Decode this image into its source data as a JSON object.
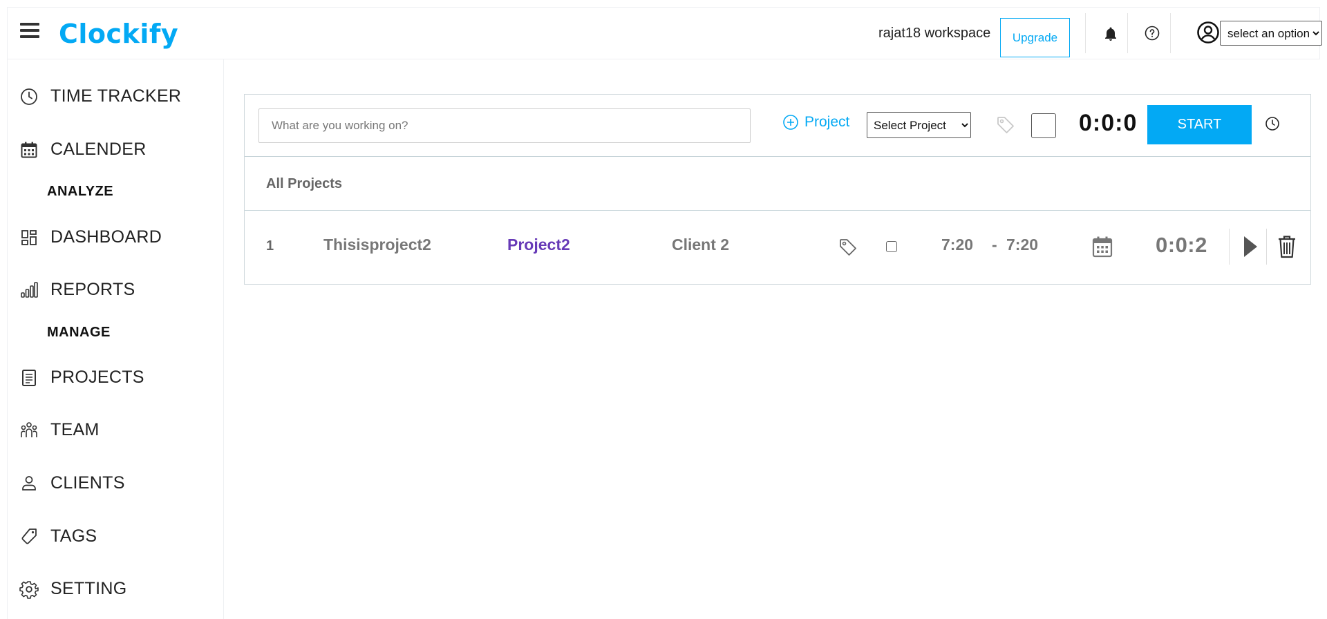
{
  "header": {
    "logo_text": "Clockify",
    "workspace": "rajat18 workspace",
    "upgrade_label": "Upgrade",
    "user_select_value": "select an option"
  },
  "sidebar": {
    "items": [
      {
        "label": "TIME TRACKER",
        "icon": "clock-icon"
      },
      {
        "label": "CALENDER",
        "icon": "calendar-icon"
      },
      {
        "label": "DASHBOARD",
        "icon": "dashboard-icon"
      },
      {
        "label": "REPORTS",
        "icon": "bar-chart-icon"
      },
      {
        "label": "PROJECTS",
        "icon": "document-icon"
      },
      {
        "label": "TEAM",
        "icon": "team-icon"
      },
      {
        "label": "CLIENTS",
        "icon": "person-icon"
      },
      {
        "label": "TAGS",
        "icon": "tag-icon"
      },
      {
        "label": "SETTING",
        "icon": "gear-icon"
      }
    ],
    "sections": {
      "analyze": "ANALYZE",
      "manage": "MANAGE"
    }
  },
  "tracker": {
    "placeholder": "What are you working on?",
    "project_label": "Project",
    "project_select_value": "Select Project",
    "timer": "0:0:0",
    "start_label": "START"
  },
  "list": {
    "heading": "All Projects",
    "entries": [
      {
        "number": "1",
        "description": "Thisisproject2",
        "project": "Project2",
        "client": "Client 2",
        "start": "7:20",
        "separator": "-",
        "end": "7:20",
        "duration": "0:0:2"
      }
    ]
  },
  "colors": {
    "accent": "#03a9f4",
    "project": "#673ab7",
    "muted_text": "#777777"
  }
}
